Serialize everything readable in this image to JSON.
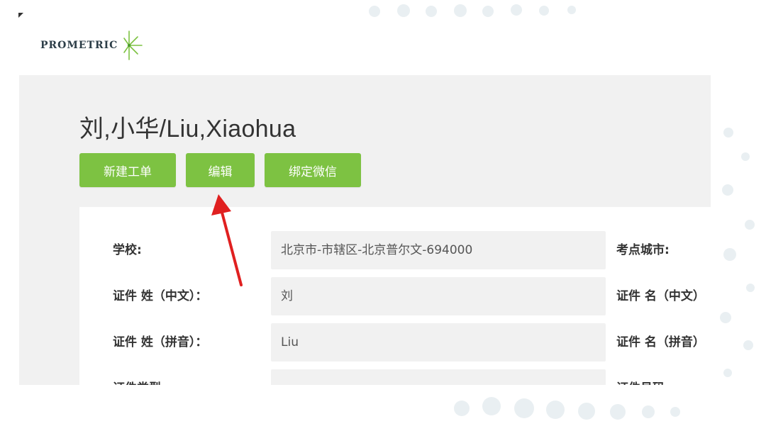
{
  "logo": {
    "text": "PROMETRIC"
  },
  "profile": {
    "name": "刘,小华/Liu,Xiaohua"
  },
  "actions": {
    "new_ticket": "新建工单",
    "edit": "编辑",
    "bind_wechat": "绑定微信"
  },
  "form": {
    "rows": [
      {
        "label": "学校:",
        "value": "北京市-市辖区-北京普尔文-694000",
        "right_label": "考点城市:"
      },
      {
        "label": "证件 姓（中文）：",
        "value": "刘",
        "right_label": "证件 名（中文）"
      },
      {
        "label": "证件 姓（拼音）：",
        "value": "Liu",
        "right_label": "证件 名（拼音）"
      },
      {
        "label": "证件类型",
        "value": "",
        "right_label": "证件号码"
      }
    ]
  },
  "colors": {
    "accent": "#7dc242",
    "panel_bg": "#f1f1f1",
    "arrow": "#e02020"
  },
  "icons": {
    "logo": "prometric-starburst-icon",
    "annotation": "red-arrow-annotation"
  }
}
